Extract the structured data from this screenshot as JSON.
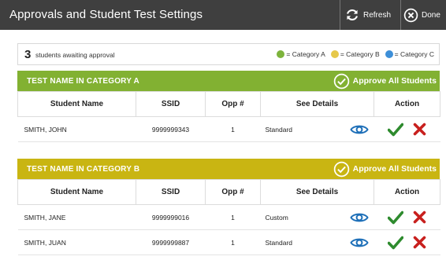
{
  "header": {
    "title": "Approvals and Student Test Settings",
    "refresh_label": "Refresh",
    "done_label": "Done"
  },
  "summary": {
    "count": "3",
    "text": "students awaiting approval",
    "legend": [
      {
        "label": "= Category A",
        "color": "#7db33c"
      },
      {
        "label": "= Category B",
        "color": "#e6c84a"
      },
      {
        "label": "= Category C",
        "color": "#3d8fd8"
      }
    ]
  },
  "columns": {
    "student": "Student Name",
    "ssid": "SSID",
    "opp": "Opp #",
    "details": "See Details",
    "action": "Action"
  },
  "sections": [
    {
      "name": "TEST NAME IN CATEGORY A",
      "approve_all": "Approve All Students",
      "color": "#82b132",
      "rows": [
        {
          "name": "SMITH, JOHN",
          "ssid": "9999999343",
          "opp": "1",
          "details": "Standard"
        }
      ]
    },
    {
      "name": "TEST NAME IN CATEGORY B",
      "approve_all": "Approve All Students",
      "color": "#c9b512",
      "rows": [
        {
          "name": "SMITH, JANE",
          "ssid": "9999999016",
          "opp": "1",
          "details": "Custom"
        },
        {
          "name": "SMITH, JUAN",
          "ssid": "9999999887",
          "opp": "1",
          "details": "Standard"
        }
      ]
    }
  ],
  "icons": {
    "refresh": "refresh-icon",
    "done": "close-circle-icon",
    "approve_all": "check-circle-icon",
    "details": "eye-icon",
    "approve": "checkmark-icon",
    "deny": "x-icon"
  },
  "colors": {
    "titlebar": "#3f3f3f",
    "approve": "#2e8b2e",
    "deny": "#c8201e",
    "eye": "#1d6fb8"
  }
}
